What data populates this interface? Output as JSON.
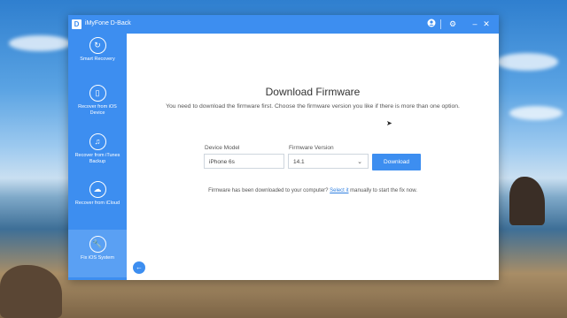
{
  "window": {
    "title": "iMyFone D-Back",
    "logo_letter": "D"
  },
  "titlebar": {
    "icons": [
      "account-icon",
      "settings-icon",
      "minimize-icon",
      "close-icon"
    ]
  },
  "sidebar": {
    "items": [
      {
        "label": "Smart Recovery",
        "icon": "smart-recovery-icon",
        "active": false
      },
      {
        "label": "Recover from iOS Device",
        "icon": "device-icon",
        "active": false
      },
      {
        "label": "Recover from iTunes Backup",
        "icon": "itunes-icon",
        "active": false
      },
      {
        "label": "Recover from iCloud",
        "icon": "icloud-icon",
        "active": false
      },
      {
        "label": "Fix iOS System",
        "icon": "wrench-icon",
        "active": true
      }
    ]
  },
  "main": {
    "title": "Download Firmware",
    "description": "You need to download the firmware first. Choose the firmware version you like if there is more than one option.",
    "device_model_label": "Device Model",
    "device_model_value": "iPhone 6s",
    "firmware_version_label": "Firmware Version",
    "firmware_version_value": "14.1",
    "download_label": "Download",
    "note_prefix": "Firmware has been downloaded to your computer? ",
    "note_link": "Select it",
    "note_suffix": " manually to start the fix now."
  },
  "colors": {
    "accent": "#3d8ef0",
    "link": "#2f7fe0"
  }
}
